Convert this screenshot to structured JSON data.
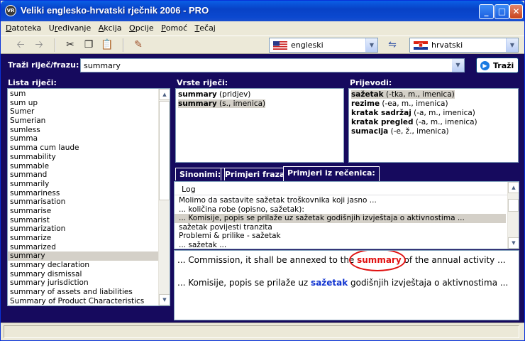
{
  "window": {
    "title": "Veliki englesko-hrvatski rječnik 2006 - PRO",
    "icon_text": "VR"
  },
  "menu": [
    "Datoteka",
    "Uređivanje",
    "Akcija",
    "Opcije",
    "Pomoć",
    "Tečaj"
  ],
  "menu_underline": [
    "D",
    "r",
    "A",
    "O",
    "P",
    "T"
  ],
  "toolbar": {
    "icons": [
      "back-arrow-icon",
      "forward-arrow-icon",
      "cut-icon",
      "copy-icon",
      "paste-icon",
      "edit-book-icon",
      "swap-languages-icon"
    ],
    "source_language": "engleski",
    "target_language": "hrvatski"
  },
  "search": {
    "label": "Traži riječ/frazu:",
    "value": "summary",
    "button": "Traži"
  },
  "word_list": {
    "label": "Lista riječi:",
    "items": [
      "sum",
      "sum up",
      "Sumer",
      "Sumerian",
      "sumless",
      "summa",
      "summa cum laude",
      "summability",
      "summable",
      "summand",
      "summarily",
      "summariness",
      "summarisation",
      "summarise",
      "summarist",
      "summarization",
      "summarize",
      "summarized",
      "summary",
      "summary declaration",
      "summary dismissal",
      "summary jurisdiction",
      "summary of assets and liabilities",
      "Summary of Product Characteristics"
    ],
    "selected_index": 18
  },
  "word_types": {
    "label": "Vrste riječi:",
    "items": [
      {
        "word": "summary",
        "info": "(pridjev)"
      },
      {
        "word": "summary",
        "info": "(s., imenica)"
      }
    ],
    "selected_index": 1
  },
  "translations": {
    "label": "Prijevodi:",
    "items": [
      {
        "word": "sažetak",
        "info": "(-tka, m., imenica)"
      },
      {
        "word": "rezime",
        "info": "(-ea, m., imenica)"
      },
      {
        "word": "kratak sadržaj",
        "info": "(-a, m., imenica)"
      },
      {
        "word": "kratak pregled",
        "info": "(-a, m., imenica)"
      },
      {
        "word": "sumacija",
        "info": "(-e, ž., imenica)"
      }
    ],
    "selected_index": 0
  },
  "tabs": [
    "Sinonimi:",
    "Primjeri fraza:",
    "Primjeri iz rečenica:"
  ],
  "active_tab": 2,
  "examples": {
    "header": "Log",
    "rows": [
      "Molimo da sastavite sažetak troškovnika koji jasno ...",
      "... količina robe (opisno, sažetak):",
      "... Komisije, popis se prilaže uz sažetak godišnjih izvještaja o aktivnostima ...",
      "sažetak povijesti tranzita",
      "Problemi & prilike - sažetak",
      "... sažetak ..."
    ],
    "selected_index": 2
  },
  "example_detail": {
    "en_before": "... Commission, it shall be annexed to the ",
    "en_highlight": "summary",
    "en_after": " of the annual activity ...",
    "hr_before": "... Komisije, popis se prilaže uz ",
    "hr_highlight": "sažetak",
    "hr_after": " godišnjih izvještaja o aktivnostima ..."
  },
  "colors": {
    "panel_bg": "#160a5e",
    "highlight_red": "#e01010",
    "highlight_blue": "#1033d0",
    "titlebar": "#0842c6"
  }
}
